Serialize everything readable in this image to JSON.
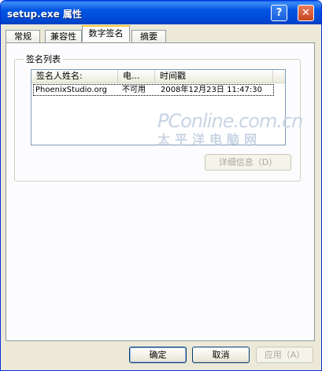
{
  "window": {
    "title": "setup.exe 属性",
    "help_glyph": "?",
    "close_glyph": "✕"
  },
  "tabs": [
    {
      "label": "常规"
    },
    {
      "label": "兼容性"
    },
    {
      "label": "数字签名"
    },
    {
      "label": "摘要"
    }
  ],
  "signature_group": {
    "label": "签名列表",
    "columns": [
      "签名人姓名:",
      "电...",
      "时间戳"
    ],
    "rows": [
      [
        "PhoenixStudio.org",
        "不可用",
        "2008年12月23日 11:47:30"
      ]
    ],
    "details_button": "详细信息（D）"
  },
  "watermark": {
    "line1": "PConline.com.cn",
    "line2": "太平洋电脑网"
  },
  "footer": {
    "ok": "确定",
    "cancel": "取消",
    "apply": "应用（A）"
  }
}
